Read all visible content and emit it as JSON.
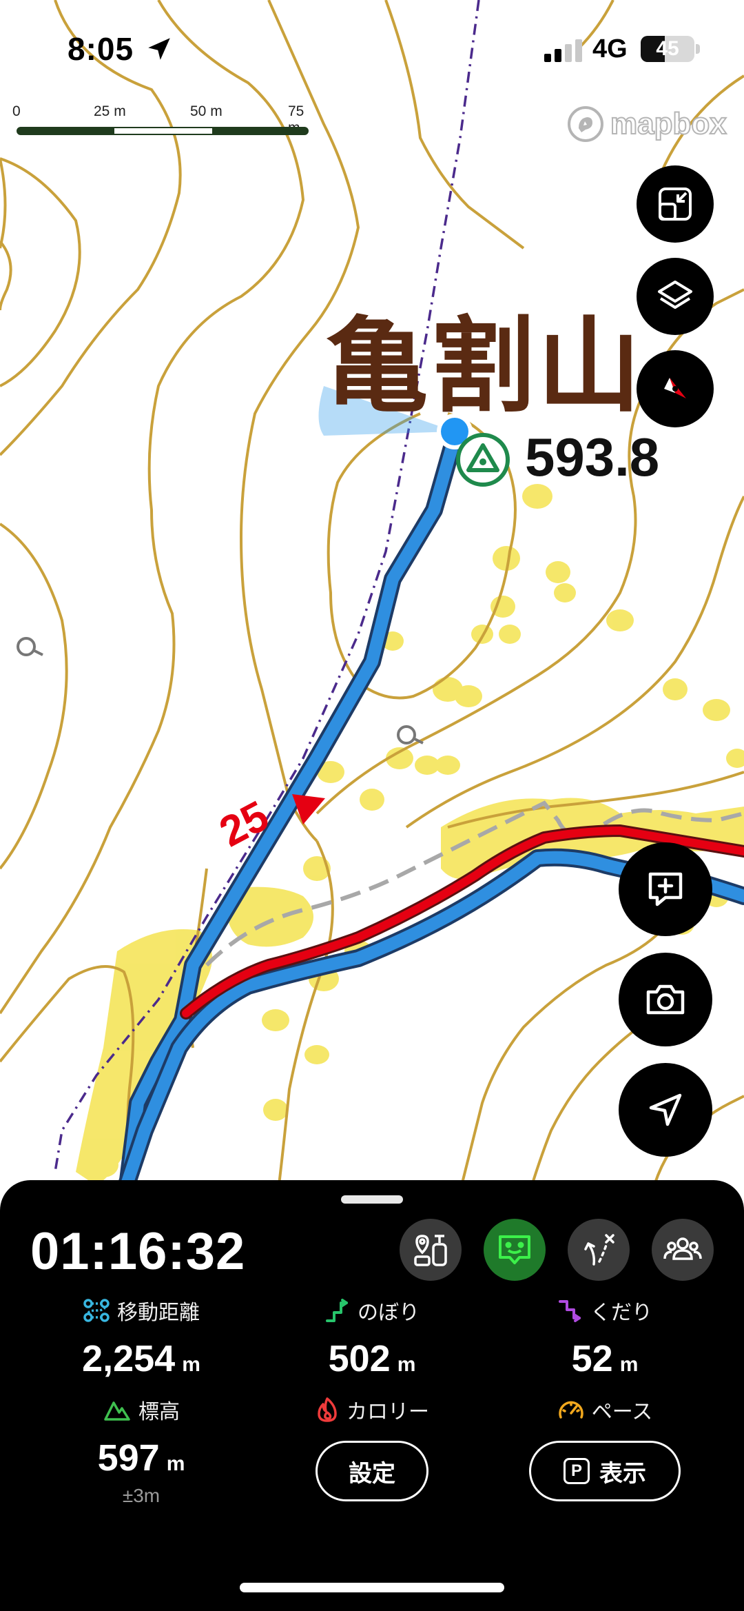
{
  "status_bar": {
    "time": "8:05",
    "network": "4G",
    "battery_percent": 45,
    "battery_label": "45"
  },
  "map": {
    "attribution": "mapbox",
    "scale": {
      "labels": [
        "0",
        "25 m",
        "50 m",
        "75 m"
      ]
    },
    "peak": {
      "name": "亀割山",
      "elevation": "593.8"
    },
    "checkpoint_label": "25",
    "colors": {
      "contour": "#c9a13b",
      "track": "#2f8fe0",
      "route_red": "#e50012",
      "trail_dash": "#a8a8a8",
      "boundary": "#4b2a8c",
      "vegetation": "#f5e663"
    }
  },
  "fabs": {
    "fullscreen_icon": "collapse-icon",
    "layers_icon": "layers-icon",
    "compass_icon": "compass-icon",
    "add_memo_icon": "add-memo-icon",
    "camera_icon": "camera-icon",
    "locate_icon": "locate-icon"
  },
  "panel": {
    "timer": "01:16:32",
    "mode_buttons": [
      {
        "icon": "checkpoint-list-icon",
        "active": false
      },
      {
        "icon": "chat-face-icon",
        "active": true
      },
      {
        "icon": "route-deviation-icon",
        "active": false
      },
      {
        "icon": "group-icon",
        "active": false
      }
    ],
    "stats": {
      "distance": {
        "label": "移動距離",
        "value": "2,254",
        "unit": "m",
        "icon": "distance-icon",
        "color": "#38b6e0"
      },
      "ascent": {
        "label": "のぼり",
        "value": "502",
        "unit": "m",
        "icon": "ascent-icon",
        "color": "#27c46b"
      },
      "descent": {
        "label": "くだり",
        "value": "52",
        "unit": "m",
        "icon": "descent-icon",
        "color": "#b04be0"
      },
      "altitude": {
        "label": "標高",
        "value": "597",
        "unit": "m",
        "accuracy": "±3m",
        "icon": "mountain-icon",
        "color": "#3fbf4f"
      },
      "calorie": {
        "label": "カロリー",
        "icon": "flame-icon",
        "color": "#ef3b3b"
      },
      "pace": {
        "label": "ペース",
        "icon": "speedometer-icon",
        "color": "#f2a81d"
      }
    },
    "settings_button": "設定",
    "show_button": {
      "badge": "P",
      "label": "表示"
    }
  }
}
